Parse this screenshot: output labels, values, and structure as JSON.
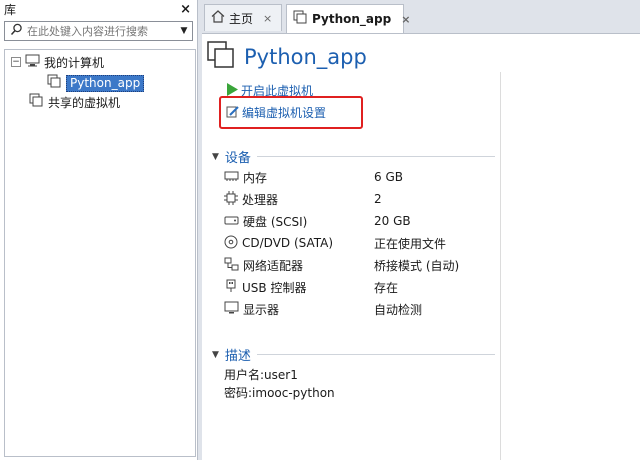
{
  "library": {
    "title": "库",
    "close": "×",
    "search_placeholder": "在此处键入内容进行搜索",
    "tree": {
      "my_computer": "我的计算机",
      "vm": "Python_app",
      "shared": "共享的虚拟机"
    }
  },
  "tabs": [
    {
      "label": "主页",
      "close": "×"
    },
    {
      "label": "Python_app",
      "close": "×"
    }
  ],
  "vm": {
    "title": "Python_app",
    "actions": {
      "power_on": "开启此虚拟机",
      "edit_settings": "编辑虚拟机设置"
    }
  },
  "devices": {
    "title": "设备",
    "rows": [
      {
        "name": "内存",
        "value": "6 GB",
        "icon": "memory-icon"
      },
      {
        "name": "处理器",
        "value": "2",
        "icon": "cpu-icon"
      },
      {
        "name": "硬盘 (SCSI)",
        "value": "20 GB",
        "icon": "disk-icon"
      },
      {
        "name": "CD/DVD (SATA)",
        "value": "正在使用文件",
        "icon": "cd-icon"
      },
      {
        "name": "网络适配器",
        "value": "桥接模式 (自动)",
        "icon": "network-icon"
      },
      {
        "name": "USB 控制器",
        "value": "存在",
        "icon": "usb-icon"
      },
      {
        "name": "显示器",
        "value": "自动检测",
        "icon": "display-icon"
      }
    ]
  },
  "description": {
    "title": "描述",
    "lines": [
      "用户名:user1",
      "密码:imooc-python"
    ]
  },
  "colors": {
    "accent": "#1c5fb0",
    "highlight": "#e02020",
    "selection": "#3c78c8"
  }
}
